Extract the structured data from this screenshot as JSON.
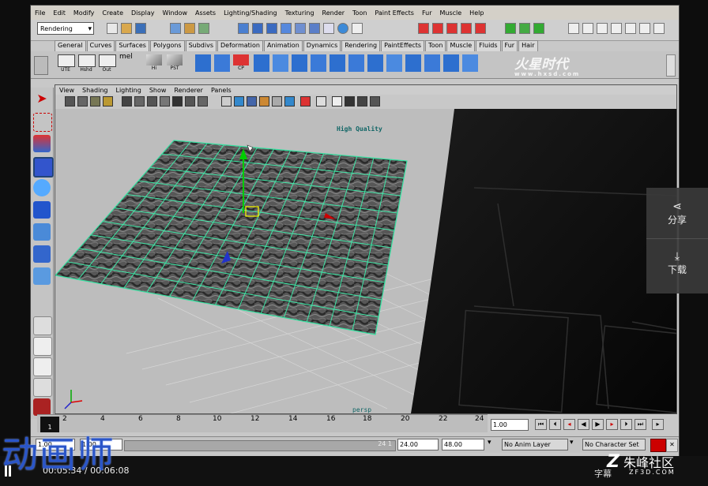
{
  "menubar": [
    "File",
    "Edit",
    "Modify",
    "Create",
    "Display",
    "Window",
    "Assets",
    "Lighting/Shading",
    "Texturing",
    "Render",
    "Toon",
    "Paint Effects",
    "Fur",
    "Muscle",
    "Help"
  ],
  "mode_selector": "Rendering",
  "shelf_tabs": [
    "General",
    "Curves",
    "Surfaces",
    "Polygons",
    "Subdivs",
    "Deformation",
    "Animation",
    "Dynamics",
    "Rendering",
    "PaintEffects",
    "Toon",
    "Muscle",
    "Fluids",
    "Fur",
    "Hair"
  ],
  "shelf_labels": [
    "UTE",
    "Hshd",
    "Out",
    "mel",
    "Hi",
    "PST",
    "CP"
  ],
  "panel_menu": [
    "View",
    "Shading",
    "Lighting",
    "Show",
    "Renderer",
    "Panels"
  ],
  "viewport": {
    "quality_label": "High Quality",
    "camera_label": "persp"
  },
  "timeline": {
    "ticks": [
      "2",
      "4",
      "6",
      "8",
      "10",
      "12",
      "14",
      "16",
      "18",
      "20",
      "22",
      "24"
    ],
    "current_frame": "1",
    "frame_field": "1.00",
    "current_marker": "24 1"
  },
  "range": {
    "start": "1.00",
    "inner_start": "1.00",
    "inner_end": "24.00",
    "end": "48.00",
    "anim_layer": "No Anim Layer",
    "char_set": "No Character Set"
  },
  "overlay": {
    "share": "分享",
    "download": "下载",
    "watermark_text": "动画师",
    "time": "00:05:34 / 00:06:08",
    "caption_label": "字幕",
    "brand": "朱峰社区",
    "brand_sub": "ZF3D.COM",
    "logo_text": "火星时代",
    "logo_url": "www.hxsd.com"
  }
}
